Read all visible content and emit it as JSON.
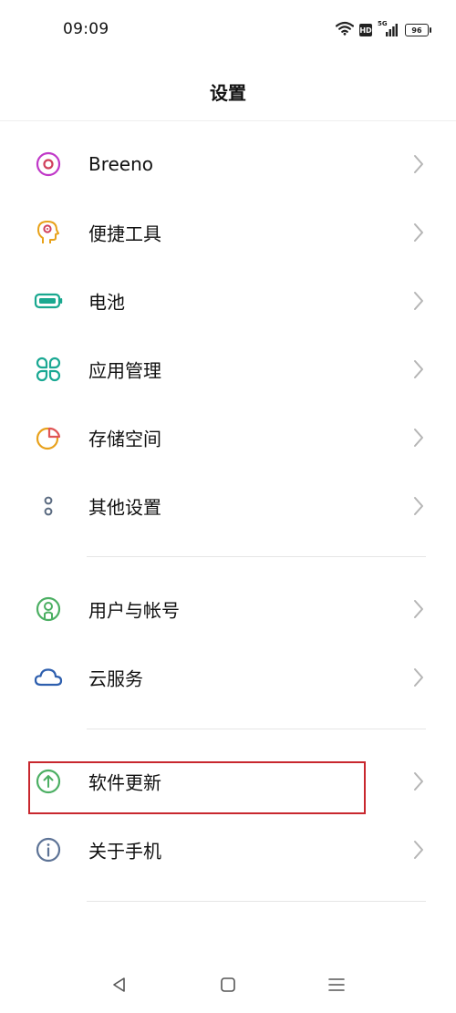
{
  "status_bar": {
    "time": "09:09",
    "hd": "HD",
    "network": "5G",
    "battery": "96"
  },
  "header": {
    "title": "设置"
  },
  "settings": [
    {
      "label": "Breeno",
      "icon": "breeno-icon",
      "color": "#c038c8"
    },
    {
      "label": "便捷工具",
      "icon": "convenience-tools-icon",
      "color": "#e8a21a"
    },
    {
      "label": "电池",
      "icon": "battery-icon",
      "color": "#19a88f"
    },
    {
      "label": "应用管理",
      "icon": "app-management-icon",
      "color": "#1aa893"
    },
    {
      "label": "存储空间",
      "icon": "storage-icon",
      "color": "#e8a11b"
    },
    {
      "label": "其他设置",
      "icon": "other-settings-icon",
      "color": "#5a6a80"
    },
    {
      "label": "用户与帐号",
      "icon": "user-account-icon",
      "color": "#4caf63"
    },
    {
      "label": "云服务",
      "icon": "cloud-icon",
      "color": "#2e5fae"
    },
    {
      "label": "软件更新",
      "icon": "software-update-icon",
      "color": "#4caf63"
    },
    {
      "label": "关于手机",
      "icon": "about-phone-icon",
      "color": "#5d7396"
    }
  ],
  "colors": {
    "highlight": "#c8272e",
    "chevron": "#b5b5b5"
  },
  "nav": {
    "back": "back-icon",
    "home": "home-icon",
    "recents": "recents-icon"
  }
}
